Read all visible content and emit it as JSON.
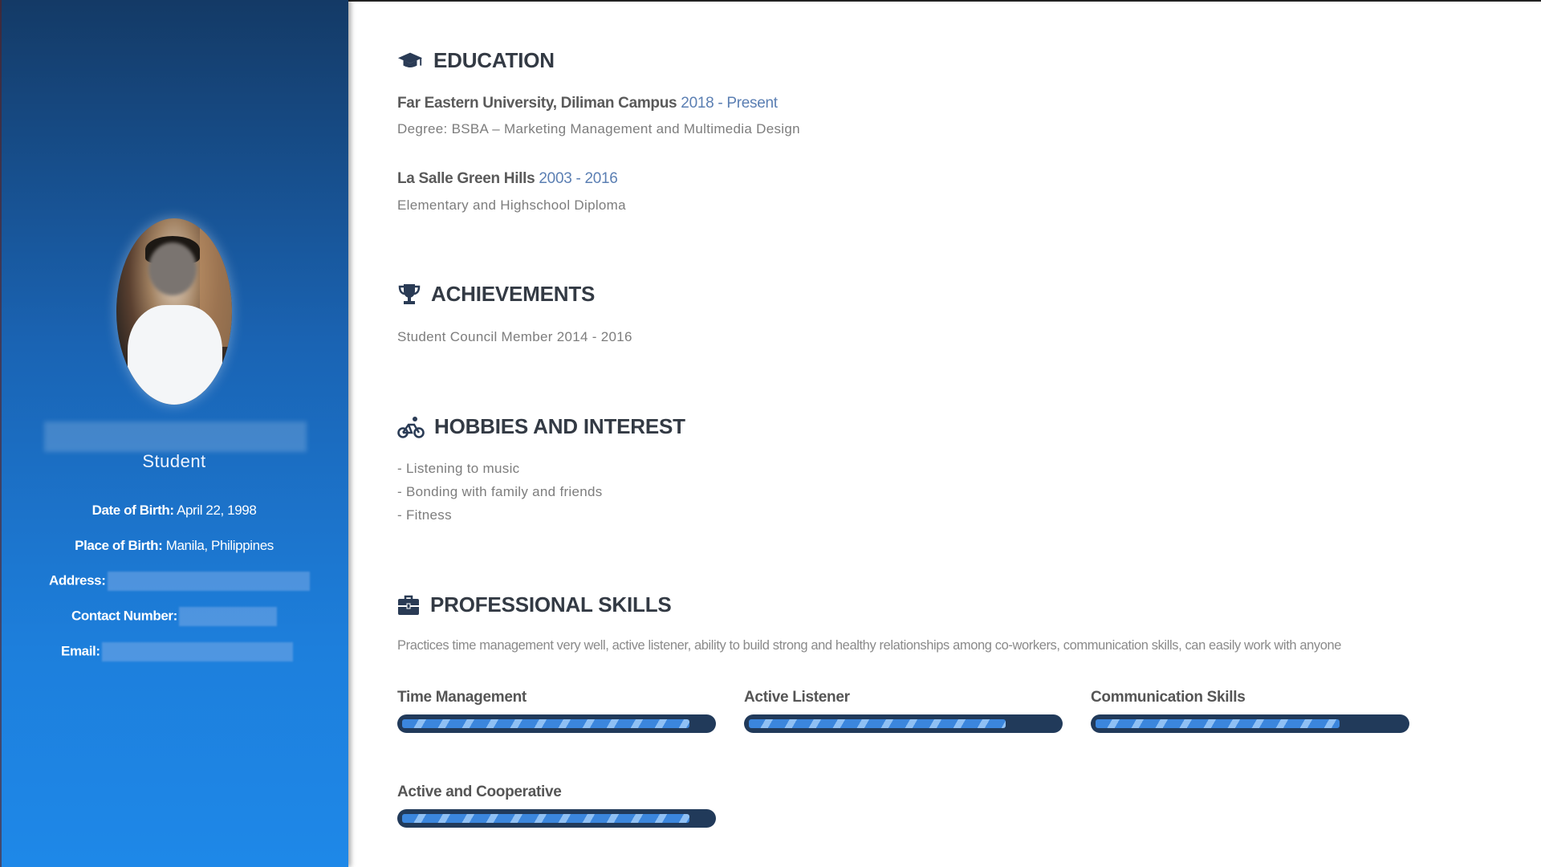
{
  "profile": {
    "role": "Student",
    "dob_label": "Date of Birth:",
    "dob_value": "April 22, 1998",
    "pob_label": "Place of Birth:",
    "pob_value": "Manila, Philippines",
    "address_label": "Address:",
    "contact_label": "Contact Number:",
    "email_label": "Email:"
  },
  "education": {
    "title": "EDUCATION",
    "icon": "graduation-cap-icon",
    "items": [
      {
        "school": "Far Eastern University, Diliman Campus",
        "years": "2018 - Present",
        "detail": "Degree: BSBA – Marketing Management and Multimedia Design"
      },
      {
        "school": "La Salle Green Hills",
        "years": "2003 - 2016",
        "detail": "Elementary and Highschool Diploma"
      }
    ]
  },
  "achievements": {
    "title": "ACHIEVEMENTS",
    "icon": "trophy-icon",
    "items": [
      {
        "text": "Student Council Member",
        "years": "2014 - 2016"
      }
    ]
  },
  "hobbies": {
    "title": "HOBBIES AND INTEREST",
    "icon": "bicycle-icon",
    "items": [
      "- Listening to music",
      "- Bonding with family and friends",
      "- Fitness"
    ]
  },
  "skills": {
    "title": "PROFESSIONAL SKILLS",
    "icon": "briefcase-icon",
    "description": "Practices time management very well, active listener, ability to build strong and healthy relationships among co-workers, communication skills, can easily work with anyone",
    "items": [
      {
        "label": "Time Management",
        "level": 0.93
      },
      {
        "label": "Active Listener",
        "level": 0.83
      },
      {
        "label": "Communication Skills",
        "level": 0.79
      },
      {
        "label": "Active and Cooperative",
        "level": 0.93
      }
    ]
  },
  "colors": {
    "sidebar_top": "#143a66",
    "sidebar_bottom": "#1e88e8",
    "heading": "#333a44",
    "year_accent": "#5b7fb3",
    "bar_track": "#213a5a",
    "bar_fill": "#3b86dd"
  }
}
